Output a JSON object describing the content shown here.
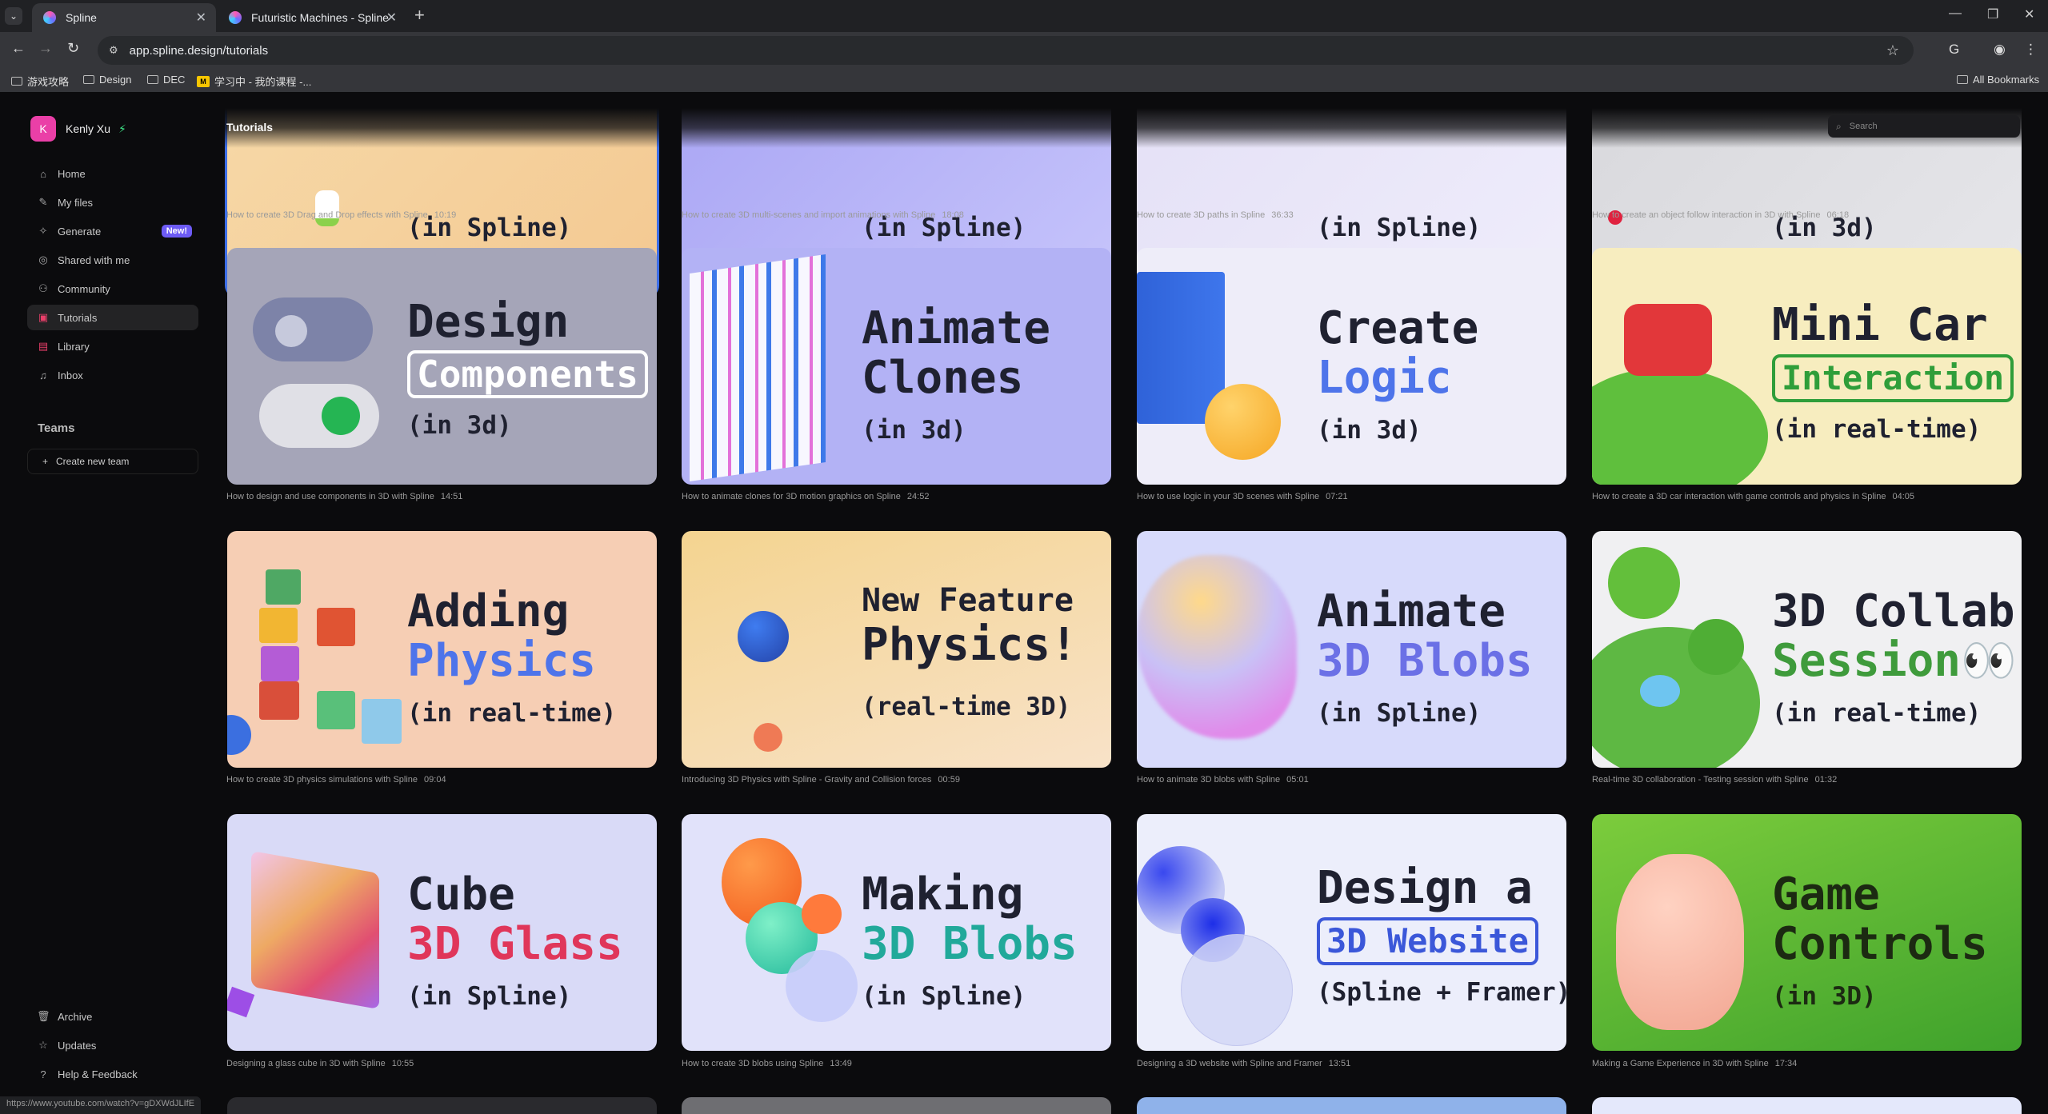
{
  "browser": {
    "tabs": [
      {
        "label": "Spline",
        "active": true
      },
      {
        "label": "Futuristic Machines - Spline",
        "active": false
      }
    ],
    "url": "app.spline.design/tutorials",
    "bookmarks": [
      {
        "label": "游戏攻略",
        "icon": "folder-icon"
      },
      {
        "label": "Design",
        "icon": "folder-icon"
      },
      {
        "label": "DEC",
        "icon": "folder-icon"
      },
      {
        "label": "学习中 - 我的课程 -...",
        "icon": "site-logo"
      }
    ],
    "all_bookmarks": "All Bookmarks",
    "status_url": "https://www.youtube.com/watch?v=gDXWdJLIfE"
  },
  "sidebar": {
    "user": {
      "initial": "K",
      "name": "Kenly Xu"
    },
    "nav": [
      {
        "label": "Home",
        "icon": "home-icon"
      },
      {
        "label": "My files",
        "icon": "pencil-icon"
      },
      {
        "label": "Generate",
        "icon": "sparkle-icon",
        "badge": "New!"
      },
      {
        "label": "Shared with me",
        "icon": "shared-icon"
      },
      {
        "label": "Community",
        "icon": "community-icon"
      },
      {
        "label": "Tutorials",
        "icon": "tutorials-icon",
        "active": true
      },
      {
        "label": "Library",
        "icon": "library-icon"
      },
      {
        "label": "Inbox",
        "icon": "bell-icon"
      }
    ],
    "teams_title": "Teams",
    "create_team": "Create new team",
    "bottom": [
      {
        "label": "Archive",
        "icon": "trash-icon"
      },
      {
        "label": "Updates",
        "icon": "star-icon"
      },
      {
        "label": "Help & Feedback",
        "icon": "help-icon"
      }
    ]
  },
  "main": {
    "title": "Tutorials",
    "search_placeholder": "Search",
    "top_row": [
      {
        "l3": "(in Spline)",
        "caption": "How to create 3D Drag and Drop effects with Spline",
        "duration": "10:19"
      },
      {
        "l3": "(in Spline)",
        "caption": "How to create 3D multi-scenes and import animations with Spline",
        "duration": "18:08"
      },
      {
        "l3": "(in Spline)",
        "caption": "How to create 3D paths in Spline",
        "duration": "36:33"
      },
      {
        "l3": "(in 3d)",
        "caption": "How to create an object follow interaction in 3D with Spline",
        "duration": "06:18"
      }
    ],
    "cards": [
      {
        "l1": "Design",
        "l2": "Components",
        "l3": "(in 3d)",
        "caption": "How to design and use components in 3D with Spline",
        "duration": "14:51"
      },
      {
        "l1": "Animate",
        "l2": "Clones",
        "l3": "(in 3d)",
        "caption": "How to animate clones for 3D motion graphics on Spline",
        "duration": "24:52"
      },
      {
        "l1": "Create",
        "l2": "Logic",
        "l3": "(in 3d)",
        "caption": "How to use logic in your 3D scenes with Spline",
        "duration": "07:21"
      },
      {
        "l1": "Mini Car",
        "l2": "Interaction",
        "l3": "(in real-time)",
        "caption": "How to create a 3D car interaction with game controls and physics in Spline",
        "duration": "04:05"
      },
      {
        "l1": "Adding",
        "l2": "Physics",
        "l3": "(in real-time)",
        "caption": "How to create 3D physics simulations with Spline",
        "duration": "09:04"
      },
      {
        "l1": "New Feature",
        "l2": "Physics!",
        "l3": "(real-time 3D)",
        "caption": "Introducing 3D Physics with Spline - Gravity and Collision forces",
        "duration": "00:59"
      },
      {
        "l1": "Animate",
        "l2": "3D Blobs",
        "l3": "(in Spline)",
        "caption": "How to animate 3D blobs with Spline",
        "duration": "05:01"
      },
      {
        "l1": "3D Collab",
        "l2": "Session👀",
        "l3": "(in real-time)",
        "caption": "Real-time 3D collaboration - Testing session with Spline",
        "duration": "01:32"
      },
      {
        "l1": "Cube",
        "l2": "3D Glass",
        "l3": "(in Spline)",
        "caption": "Designing a glass cube in 3D with Spline",
        "duration": "10:55"
      },
      {
        "l1": "Making",
        "l2": "3D Blobs",
        "l3": "(in Spline)",
        "caption": "How to create 3D blobs using Spline",
        "duration": "13:49"
      },
      {
        "l1": "Design a",
        "l2": "3D Website",
        "l3": "(Spline + Framer)",
        "caption": "Designing a 3D website with Spline and Framer",
        "duration": "13:51"
      },
      {
        "l1": "Game",
        "l2": "Controls",
        "l3": "(in 3D)",
        "caption": "Making a Game Experience in 3D with Spline",
        "duration": "17:34"
      }
    ]
  },
  "colors": {
    "accent_purple": "#6d5bf5",
    "avatar_pink": "#ea3fa7",
    "selection_blue": "#3d6ee7"
  }
}
